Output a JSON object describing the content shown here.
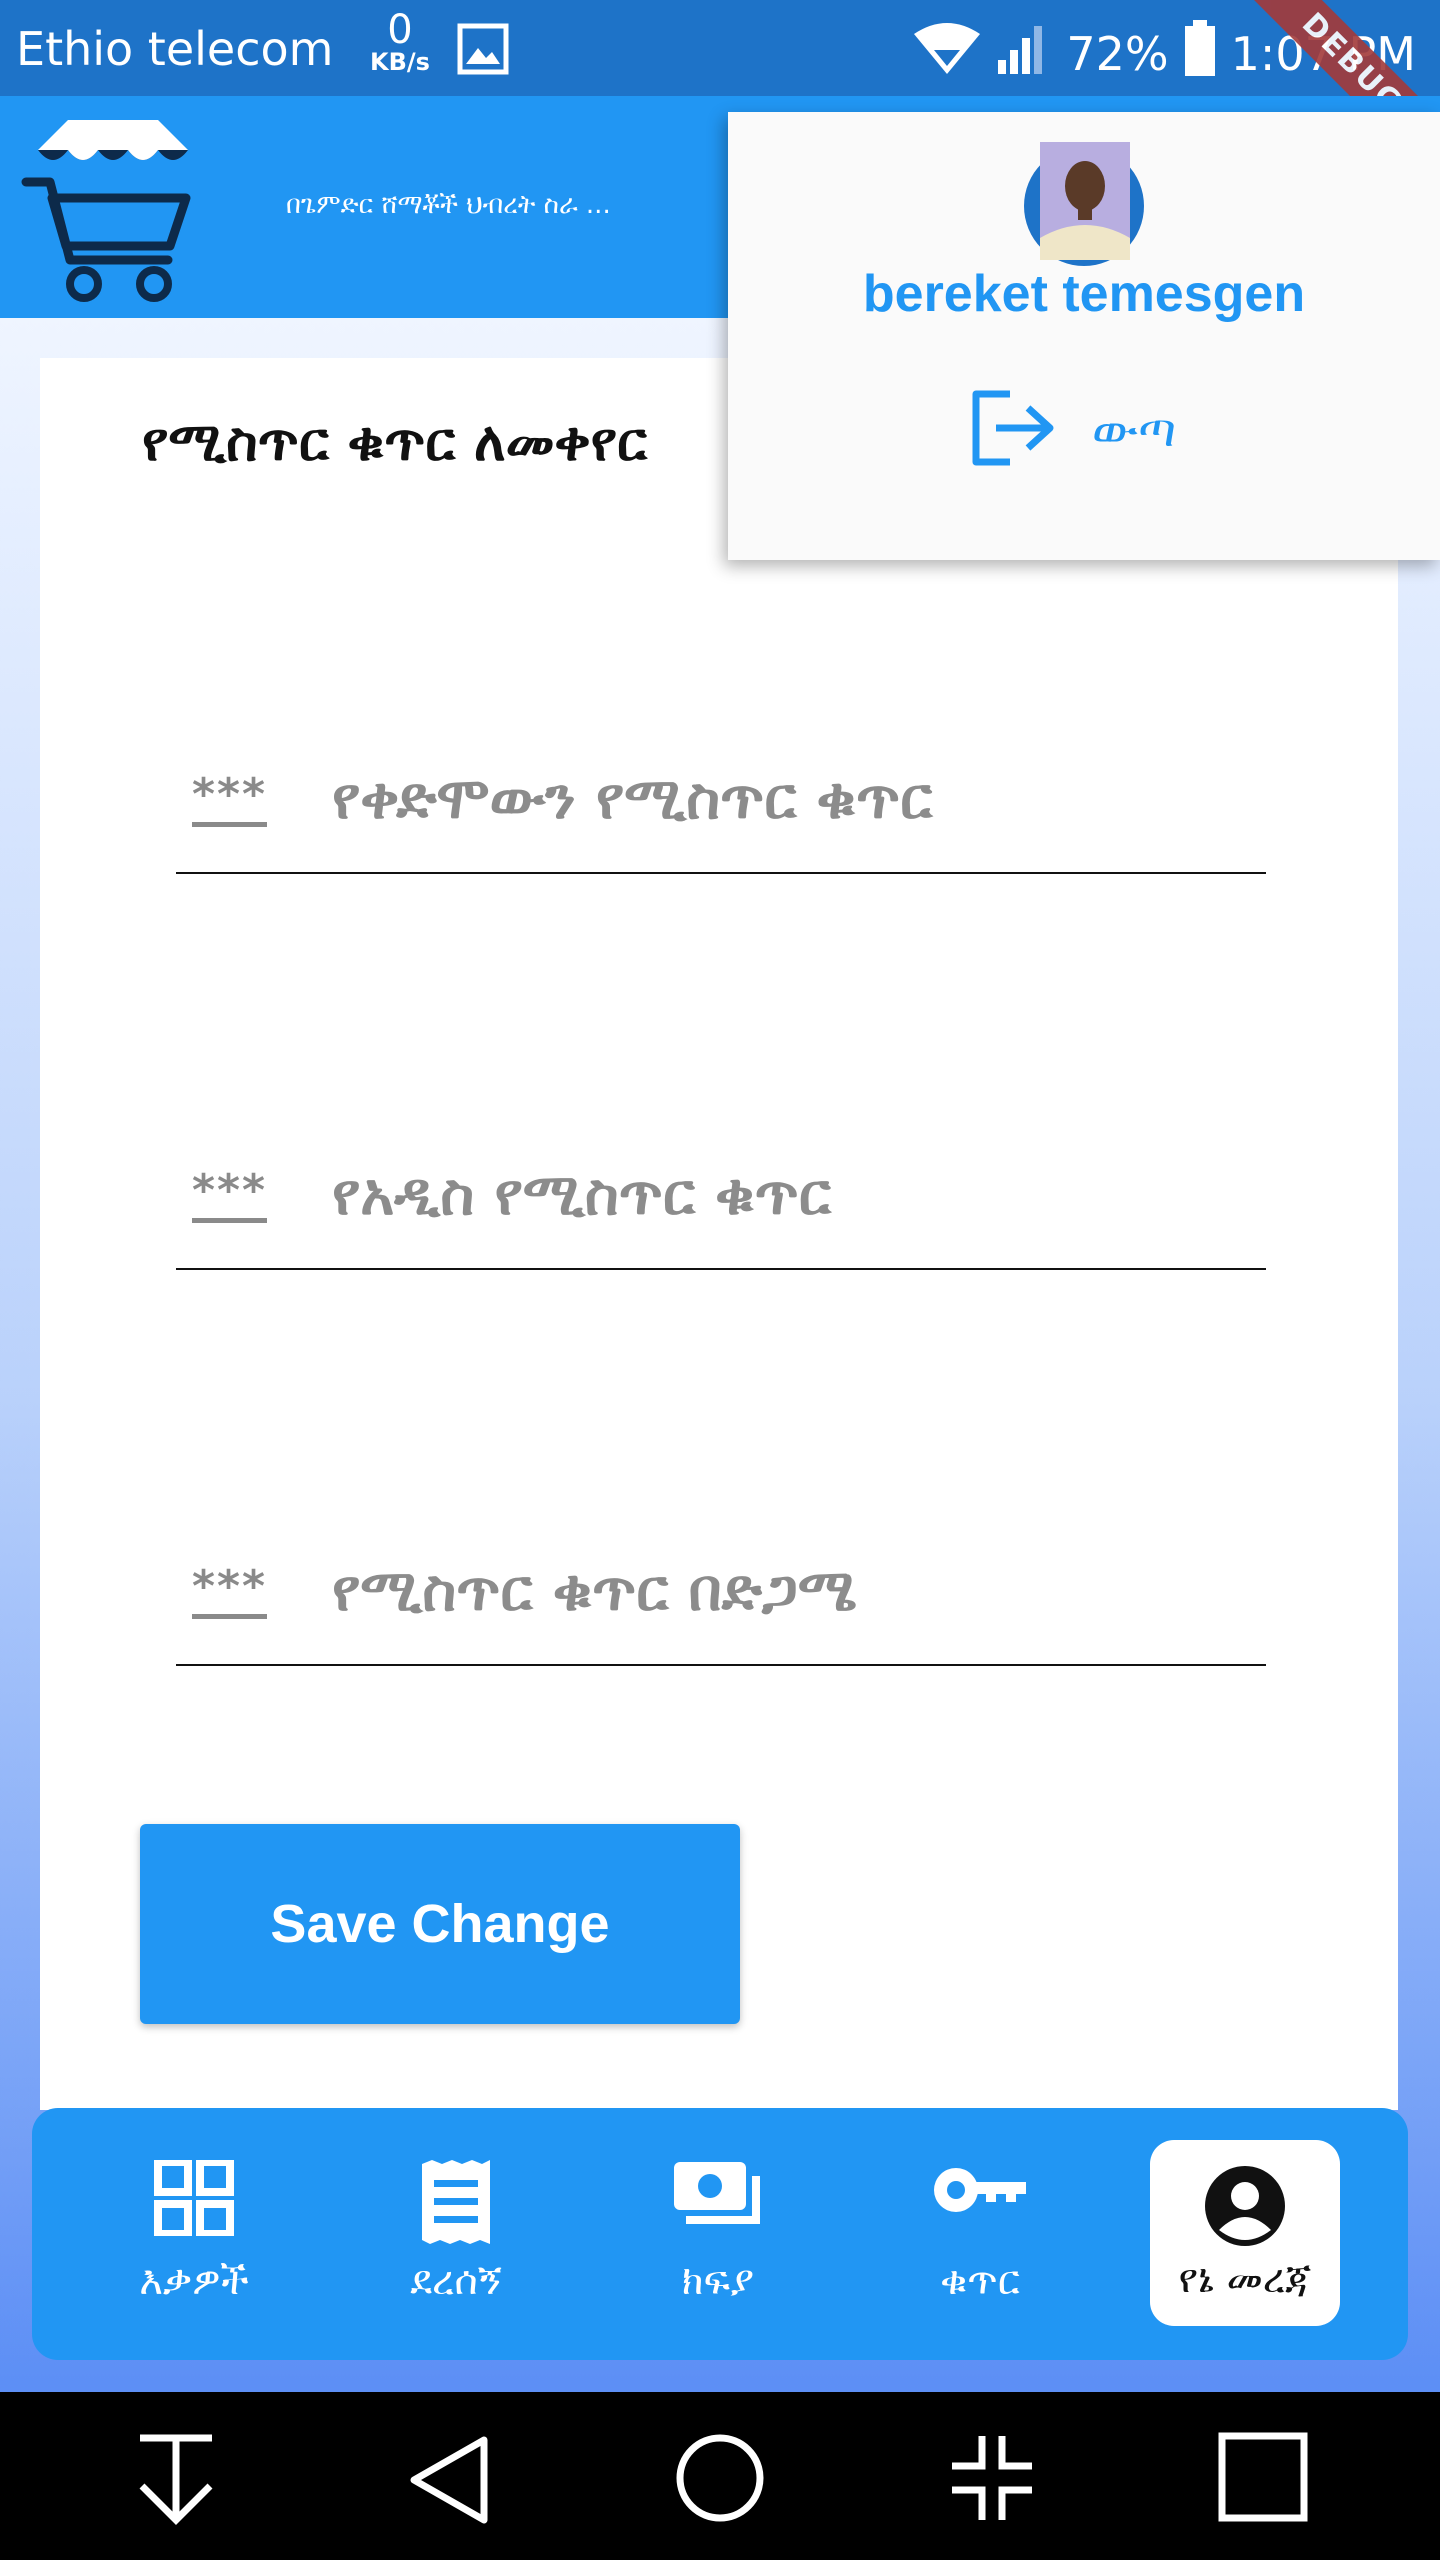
{
  "status_bar": {
    "carrier": "Ethio telecom",
    "speed_value": "0",
    "speed_unit": "KB/s",
    "battery": "72%",
    "time": "1:07 PM",
    "debug": "DEBUG"
  },
  "app_bar": {
    "subtitle": "በጌምድር ሸማቾች ህብረት ስራ ..."
  },
  "form": {
    "title": "የሚስጥር ቁጥር ለመቀየር",
    "fields": [
      {
        "mask": "***",
        "hint": "የቀድሞውን የሚስጥር ቁጥር"
      },
      {
        "mask": "***",
        "hint": "የአዲስ የሚስጥር ቁጥር"
      },
      {
        "mask": "***",
        "hint": "የሚስጥር ቁጥር በድጋሜ"
      }
    ],
    "save_label": "Save Change"
  },
  "profile_menu": {
    "username": "bereket temesgen",
    "logout_label": "ውጣ"
  },
  "bottom_nav": [
    {
      "label": "እቃዎች",
      "icon": "grid-icon"
    },
    {
      "label": "ደረሰኝ",
      "icon": "receipt-icon"
    },
    {
      "label": "ክፍያ",
      "icon": "payment-icon"
    },
    {
      "label": "ቁጥር",
      "icon": "key-icon"
    },
    {
      "label": "የኔ መረጃ",
      "icon": "account-icon",
      "active": true
    }
  ],
  "colors": {
    "primary": "#2196f3",
    "status_bar": "#1e73c8"
  }
}
